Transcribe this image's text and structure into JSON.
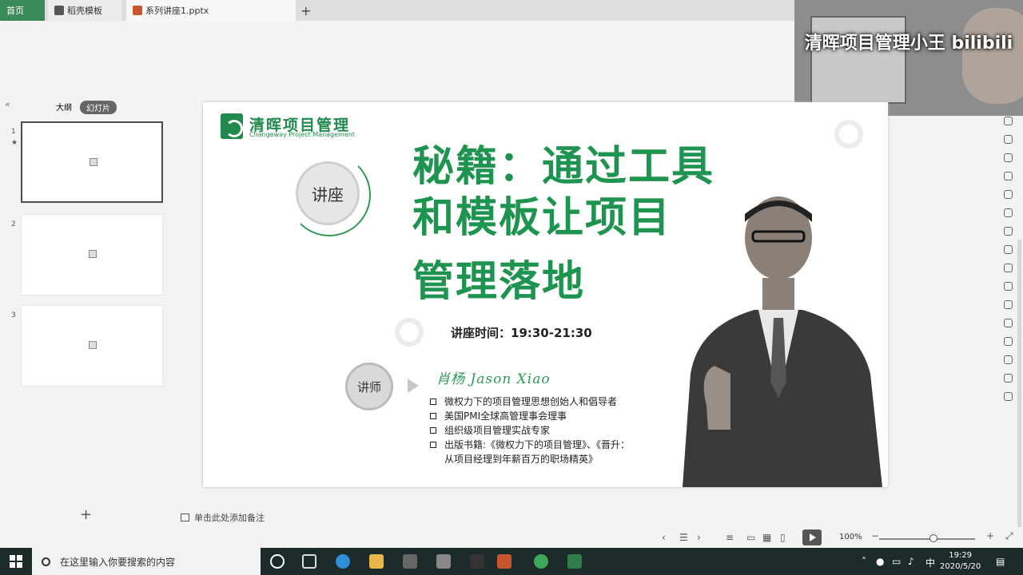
{
  "tabs": [
    {
      "label": "首页"
    },
    {
      "label": "稻壳模板"
    },
    {
      "label": "系列讲座1.pptx"
    }
  ],
  "webcam": {
    "watermark": "清晖项目管理小王 bilibili"
  },
  "outline_tabs": {
    "outline": "大纲",
    "slides": "幻灯片"
  },
  "thumbnails": [
    {
      "num": "1",
      "star": "★"
    },
    {
      "num": "2"
    },
    {
      "num": "3"
    }
  ],
  "slide": {
    "logo_cn": "清晖项目管理",
    "logo_en": "Changeway Project Management",
    "title_lines": [
      "秘籍：通过工具",
      "和模板让项目",
      "管理落地"
    ],
    "lecture_badge": "讲座",
    "time": "讲座时间：19:30-21:30",
    "teacher_badge": "讲师",
    "teacher_name": "肖杨 Jason Xiao",
    "bullets": [
      "微权力下的项目管理思想创始人和倡导者",
      "美国PMI全球高管理事会理事",
      "组织级项目管理实战专家",
      "出版书籍:《微权力下的项目管理》、《晋升：",
      "从项目经理到年薪百万的职场精英》"
    ]
  },
  "notes_placeholder": "单击此处添加备注",
  "status": {
    "zoom": "100%"
  },
  "taskbar": {
    "search_placeholder": "在这里输入你要搜索的内容",
    "ime": "中",
    "time": "19:29",
    "date": "2020/5/20"
  }
}
